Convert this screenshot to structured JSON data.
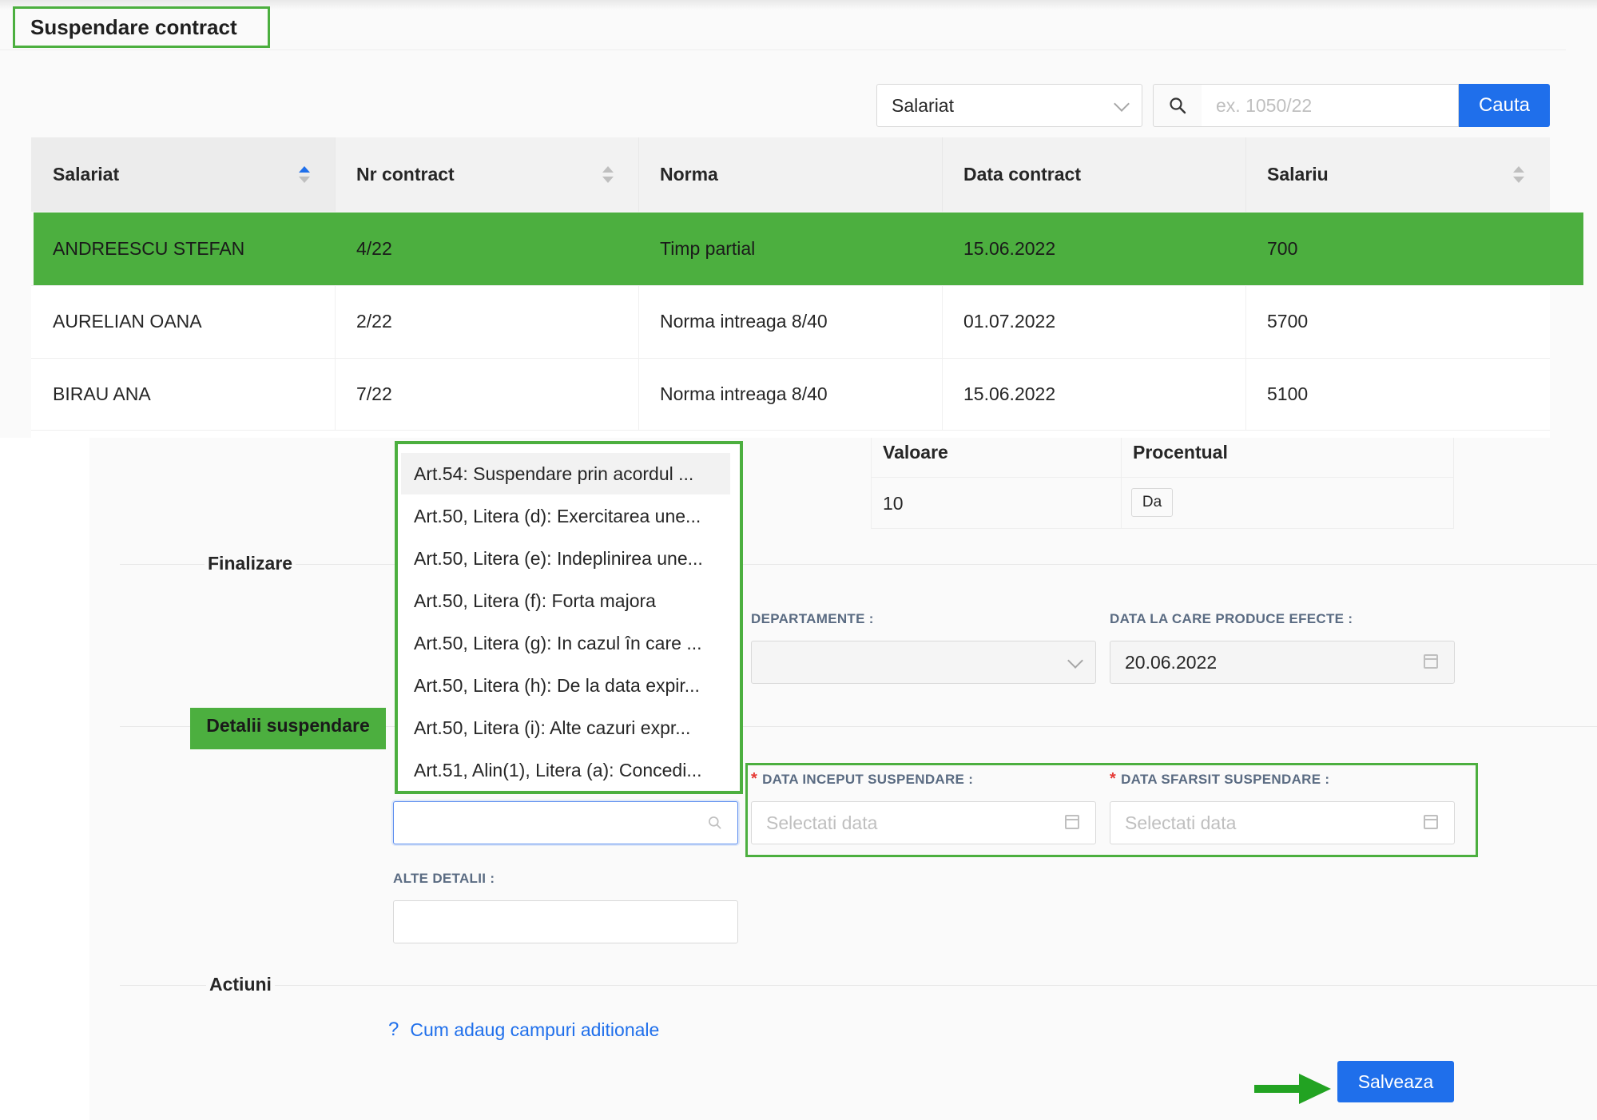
{
  "page": {
    "title": "Suspendare contract"
  },
  "filter": {
    "select_value": "Salariat",
    "search_placeholder": "ex. 1050/22",
    "search_button": "Cauta"
  },
  "table": {
    "headers": [
      "Salariat",
      "Nr contract",
      "Norma",
      "Data contract",
      "Salariu"
    ],
    "rows": [
      [
        "ANDREESCU STEFAN",
        "4/22",
        "Timp partial",
        "15.06.2022",
        "700"
      ],
      [
        "AURELIAN OANA",
        "2/22",
        "Norma intreaga 8/40",
        "01.07.2022",
        "5700"
      ],
      [
        "BIRAU ANA",
        "7/22",
        "Norma intreaga 8/40",
        "15.06.2022",
        "5100"
      ]
    ]
  },
  "small_table": {
    "headers": [
      "Valoare",
      "Procentual"
    ],
    "values": [
      "10",
      "Da"
    ]
  },
  "sections": {
    "finalizare": "Finalizare",
    "detalii": "Detalii suspendare",
    "actiuni": "Actiuni"
  },
  "dropdown": {
    "options": [
      "Art.54: Suspendare prin acordul ...",
      "Art.50, Litera (d): Exercitarea une...",
      "Art.50, Litera (e): Indeplinirea une...",
      "Art.50, Litera (f): Forta majora",
      "Art.50, Litera (g): In cazul în care ...",
      "Art.50, Litera (h): De la data expir...",
      "Art.50, Litera (i): Alte cazuri expr...",
      "Art.51, Alin(1), Litera (a): Concedi..."
    ]
  },
  "form": {
    "departamente_label": "DEPARTAMENTE :",
    "data_efecte_label": "DATA LA CARE PRODUCE EFECTE :",
    "data_efecte_value": "20.06.2022",
    "required_mark": "*",
    "data_inceput_label": "DATA INCEPUT SUSPENDARE :",
    "data_sfarsit_label": "DATA SFARSIT SUSPENDARE :",
    "date_placeholder": "Selectati data",
    "alte_detalii_label": "ALTE DETALII :"
  },
  "help": {
    "icon": "?",
    "link": "Cum adaug campuri aditionale"
  },
  "actions": {
    "save": "Salveaza"
  },
  "colors": {
    "accent": "#1f6feb",
    "highlight_green": "#4caf3f"
  }
}
